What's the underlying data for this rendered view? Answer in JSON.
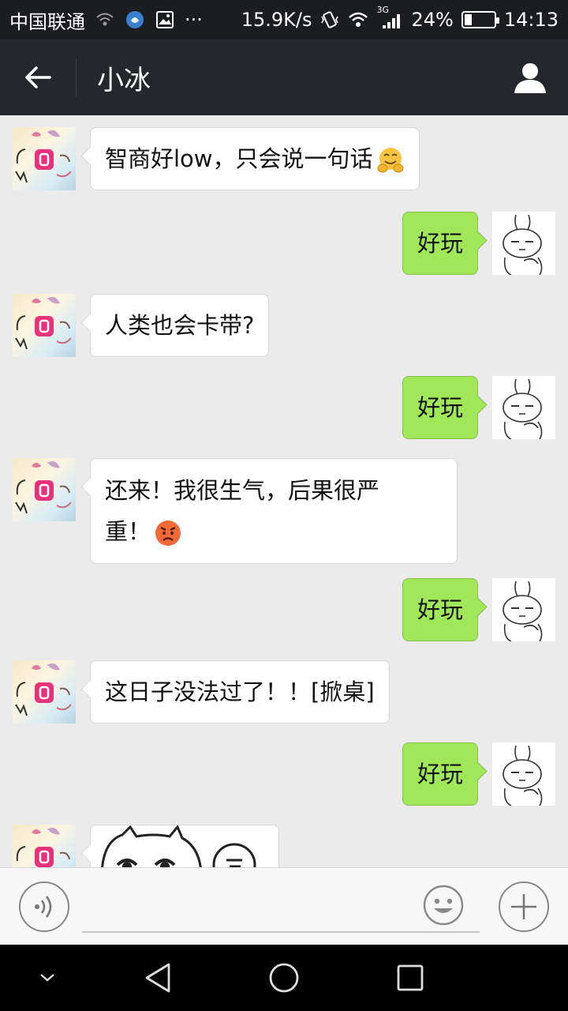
{
  "status_bar": {
    "carrier": "中国联通",
    "speed": "15.9K/s",
    "network_type": "3G",
    "battery_percent": "24%",
    "battery_level": 0.24,
    "time": "14:13",
    "more_dots": "···"
  },
  "header": {
    "title": "小冰"
  },
  "messages": [
    {
      "side": "left",
      "text": "智商好low，只会说一句话",
      "emoji": "hugging-face"
    },
    {
      "side": "right",
      "text": "好玩"
    },
    {
      "side": "left",
      "text": "人类也会卡带?"
    },
    {
      "side": "right",
      "text": "好玩"
    },
    {
      "side": "left",
      "text": "还来！我很生气，后果很严",
      "text2": "重！",
      "emoji": "angry-face"
    },
    {
      "side": "right",
      "text": "好玩"
    },
    {
      "side": "left",
      "text": "这日子没法过了！！[掀桌]"
    },
    {
      "side": "right",
      "text": "好玩"
    },
    {
      "side": "left",
      "type": "sticker"
    }
  ],
  "colors": {
    "status_bg": "#1c1d21",
    "header_bg": "#24272b",
    "chat_bg": "#ebebeb",
    "outgoing_bubble": "#a0e75a",
    "incoming_bubble": "#ffffff"
  },
  "input_bar": {
    "placeholder": ""
  }
}
